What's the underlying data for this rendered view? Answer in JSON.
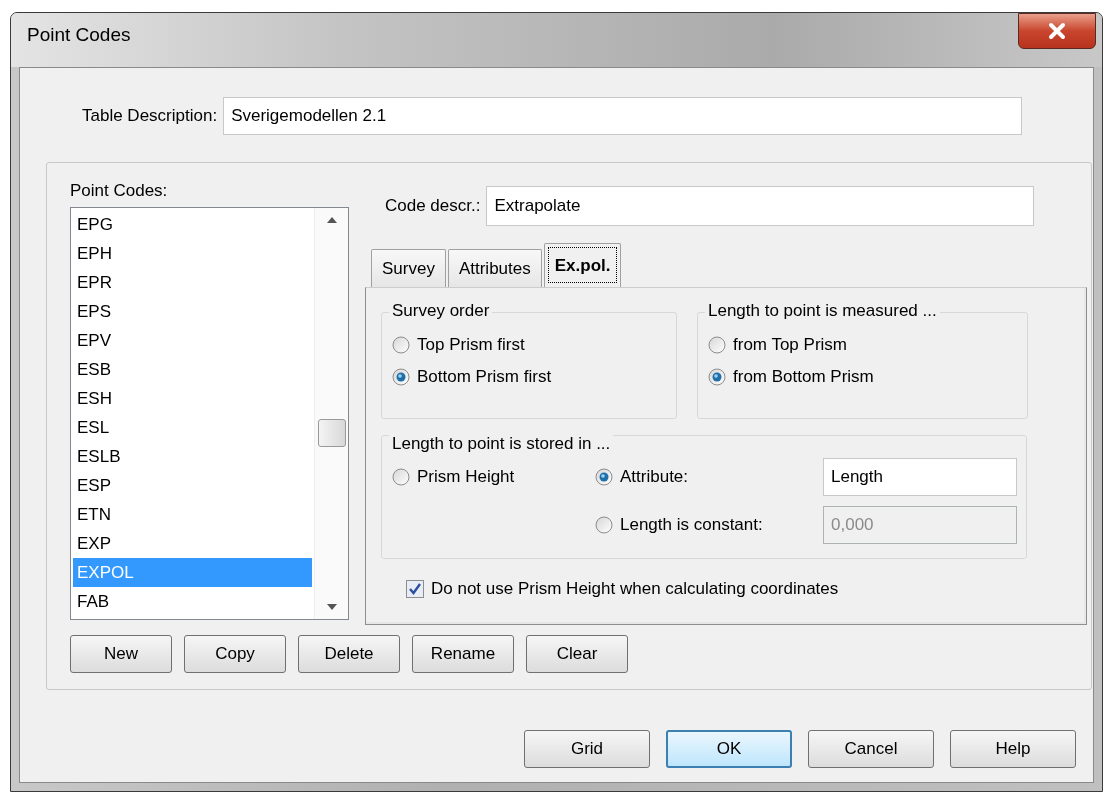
{
  "window": {
    "title": "Point Codes"
  },
  "table_description": {
    "label": "Table Description:",
    "value": "Sverigemodellen 2.1"
  },
  "point_codes": {
    "label": "Point Codes:",
    "items": [
      {
        "label": "EPG",
        "selected": false
      },
      {
        "label": "EPH",
        "selected": false
      },
      {
        "label": "EPR",
        "selected": false
      },
      {
        "label": "EPS",
        "selected": false
      },
      {
        "label": "EPV",
        "selected": false
      },
      {
        "label": "ESB",
        "selected": false
      },
      {
        "label": "ESH",
        "selected": false
      },
      {
        "label": "ESL",
        "selected": false
      },
      {
        "label": "ESLB",
        "selected": false
      },
      {
        "label": "ESP",
        "selected": false
      },
      {
        "label": "ETN",
        "selected": false
      },
      {
        "label": "EXP",
        "selected": false
      },
      {
        "label": "EXPOL",
        "selected": true
      },
      {
        "label": "FAB",
        "selected": false
      }
    ]
  },
  "code_descr": {
    "label": "Code descr.:",
    "value": "Extrapolate"
  },
  "tabs": [
    {
      "label": "Survey",
      "selected": false
    },
    {
      "label": "Attributes",
      "selected": false
    },
    {
      "label": "Ex.pol.",
      "selected": true
    }
  ],
  "survey_order": {
    "title": "Survey order",
    "options": [
      {
        "label": "Top Prism first",
        "selected": false
      },
      {
        "label": "Bottom Prism first",
        "selected": true
      }
    ]
  },
  "length_measured": {
    "title": "Length to point is measured ...",
    "options": [
      {
        "label": "from Top Prism",
        "selected": false
      },
      {
        "label": "from Bottom Prism",
        "selected": true
      }
    ]
  },
  "length_stored": {
    "title": "Length to point is stored in ...",
    "options": [
      {
        "label": "Prism Height",
        "selected": false
      },
      {
        "label": "Attribute:",
        "selected": true,
        "value": "Length",
        "disabled": false
      },
      {
        "label": "Length is constant:",
        "selected": false,
        "value": "0,000",
        "disabled": true
      }
    ]
  },
  "prism_height_checkbox": {
    "label": "Do not use Prism Height when calculating coordinates",
    "checked": true
  },
  "list_buttons": [
    "New",
    "Copy",
    "Delete",
    "Rename",
    "Clear"
  ],
  "dialog_buttons": [
    {
      "label": "Grid",
      "default": false
    },
    {
      "label": "OK",
      "default": true
    },
    {
      "label": "Cancel",
      "default": false
    },
    {
      "label": "Help",
      "default": false
    }
  ]
}
